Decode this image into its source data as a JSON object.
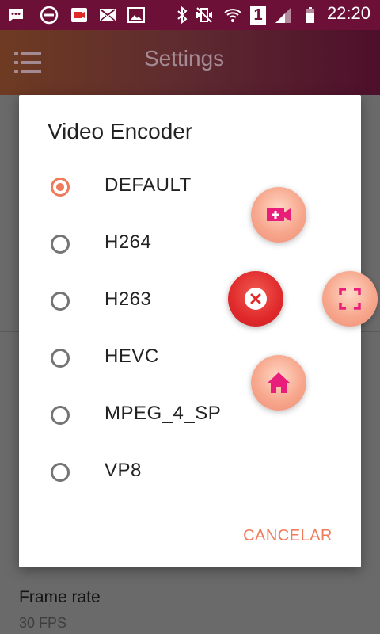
{
  "status_bar": {
    "time": "22:20",
    "sim_slot": "1",
    "icons": [
      "messages-icon",
      "do-not-disturb-icon",
      "screen-recorder-icon",
      "email-icon",
      "gallery-icon",
      "bluetooth-icon",
      "vibrate-icon",
      "wifi-icon",
      "sim-1-icon",
      "signal-icon",
      "battery-icon"
    ]
  },
  "toolbar": {
    "title": "Settings",
    "menu_icon": "hamburger-menu-icon"
  },
  "background_list": {
    "frame_rate_title": "Frame rate",
    "frame_rate_value": "30 FPS"
  },
  "dialog": {
    "title": "Video Encoder",
    "options": [
      {
        "label": "DEFAULT",
        "selected": true
      },
      {
        "label": "H264",
        "selected": false
      },
      {
        "label": "H263",
        "selected": false
      },
      {
        "label": "HEVC",
        "selected": false
      },
      {
        "label": "MPEG_4_SP",
        "selected": false
      },
      {
        "label": "VP8",
        "selected": false
      }
    ],
    "cancel_label": "CANCELAR"
  },
  "floating_widget": {
    "buttons": [
      "add-video-icon",
      "close-icon",
      "fullscreen-icon",
      "home-icon"
    ],
    "accent": "#e91e7a",
    "close_color": "#e0292b"
  },
  "colors": {
    "status_bar": "#6c1038",
    "accent": "#ef7a5c",
    "dialog_bg": "#ffffff"
  }
}
